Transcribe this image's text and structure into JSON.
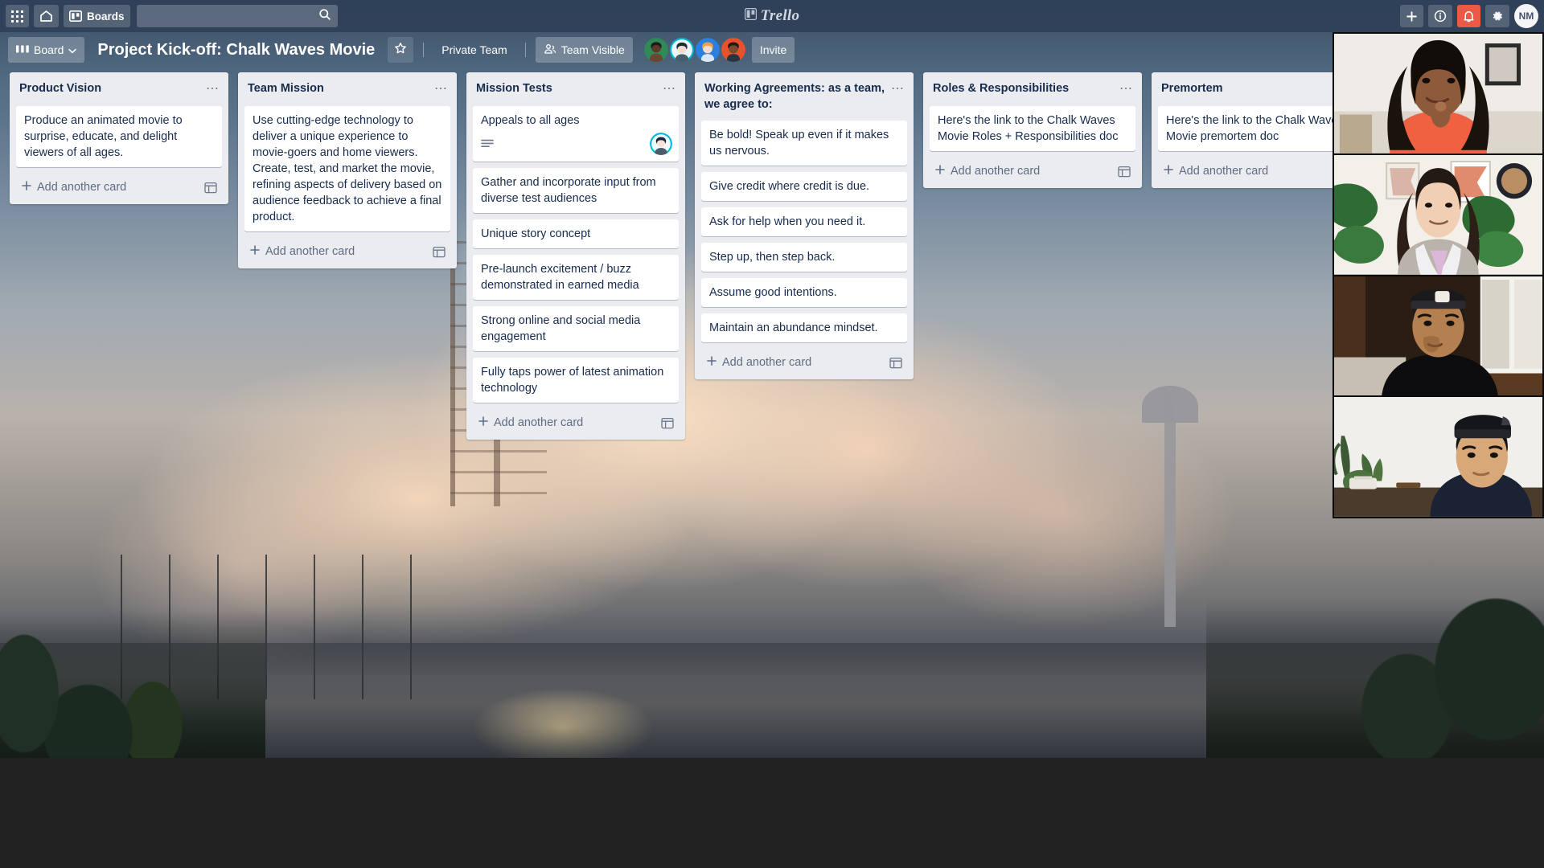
{
  "topnav": {
    "apps_icon": "grid-apps-icon",
    "home_icon": "home-icon",
    "boards_label": "Boards",
    "boards_icon": "boards-icon",
    "search_placeholder": "",
    "search_value": "",
    "search_icon": "search-icon",
    "logo_text": "Trello",
    "logo_icon": "trello-logo-icon",
    "add_icon": "plus-icon",
    "info_icon": "info-icon",
    "bell_icon": "bell-icon",
    "settings_icon": "gear-icon",
    "avatar_initials": "NM",
    "bell_color": "#eb5a46"
  },
  "boardheader": {
    "board_button_label": "Board",
    "board_button_icon": "board-view-icon",
    "board_button_caret": "chevron-down-icon",
    "title": "Project Kick-off: Chalk Waves Movie",
    "star_icon": "star-icon",
    "visibility_team_label": "Private Team",
    "visibility_label": "Team Visible",
    "visibility_icon": "team-visible-icon",
    "invite_label": "Invite",
    "members": [
      {
        "name": "member-1",
        "color": "#2e8b57",
        "skin": "#5a3a28",
        "hair": "#1b1b1b"
      },
      {
        "name": "member-2",
        "color": "#00b8d9",
        "skin": "#f3d9c8",
        "hair": "#1f2933"
      },
      {
        "name": "member-3",
        "color": "#2b7fe0",
        "skin": "#f6ddc9",
        "hair": "#f0a04b"
      },
      {
        "name": "member-4",
        "color": "#e8512e",
        "skin": "#7a4a2e",
        "hair": "#241a14"
      }
    ]
  },
  "lists": [
    {
      "title": "Product Vision",
      "menu_icon": "list-menu-icon",
      "add_card_label": "Add another card",
      "add_card_icon": "plus-icon",
      "template_icon": "card-template-icon",
      "cards": [
        {
          "text": "Produce an animated movie to surprise, educate, and delight viewers of all ages.",
          "has_description": false,
          "avatar": null
        }
      ]
    },
    {
      "title": "Team Mission",
      "menu_icon": "list-menu-icon",
      "add_card_label": "Add another card",
      "add_card_icon": "plus-icon",
      "template_icon": "card-template-icon",
      "cards": [
        {
          "text": "Use cutting-edge technology to deliver a unique experience to movie-goers and home viewers. Create, test, and market the movie, refining aspects of delivery based on audience feedback to achieve a final product.",
          "has_description": false,
          "avatar": null
        }
      ]
    },
    {
      "title": "Mission Tests",
      "menu_icon": "list-menu-icon",
      "add_card_label": "Add another card",
      "add_card_icon": "plus-icon",
      "template_icon": "card-template-icon",
      "cards": [
        {
          "text": "Appeals to all ages",
          "has_description": true,
          "avatar": {
            "name": "card-member-avatar",
            "color": "#00b8d9",
            "skin": "#f6e3d5",
            "hair": "#1c2533"
          }
        },
        {
          "text": "Gather and incorporate input from diverse test audiences",
          "has_description": false,
          "avatar": null
        },
        {
          "text": "Unique story concept",
          "has_description": false,
          "avatar": null
        },
        {
          "text": "Pre-launch excitement / buzz demonstrated in earned media",
          "has_description": false,
          "avatar": null
        },
        {
          "text": "Strong online and social media engagement",
          "has_description": false,
          "avatar": null
        },
        {
          "text": "Fully taps power of latest animation technology",
          "has_description": false,
          "avatar": null
        }
      ]
    },
    {
      "title": "Working Agreements: as a team, we agree to:",
      "menu_icon": "list-menu-icon",
      "add_card_label": "Add another card",
      "add_card_icon": "plus-icon",
      "template_icon": "card-template-icon",
      "cards": [
        {
          "text": "Be bold! Speak up even if it makes us nervous.",
          "has_description": false,
          "avatar": null
        },
        {
          "text": "Give credit where credit is due.",
          "has_description": false,
          "avatar": null
        },
        {
          "text": "Ask for help when you need it.",
          "has_description": false,
          "avatar": null
        },
        {
          "text": "Step up, then step back.",
          "has_description": false,
          "avatar": null
        },
        {
          "text": "Assume good intentions.",
          "has_description": false,
          "avatar": null
        },
        {
          "text": "Maintain an abundance mindset.",
          "has_description": false,
          "avatar": null
        }
      ]
    },
    {
      "title": "Roles & Responsibilities",
      "menu_icon": "list-menu-icon",
      "add_card_label": "Add another card",
      "add_card_icon": "plus-icon",
      "template_icon": "card-template-icon",
      "cards": [
        {
          "text": "Here's the link to the Chalk Waves Movie Roles + Responsibilities doc",
          "has_description": false,
          "avatar": null
        }
      ]
    },
    {
      "title": "Premortem",
      "menu_icon": "list-menu-icon",
      "add_card_label": "Add another card",
      "add_card_icon": "plus-icon",
      "template_icon": "card-template-icon",
      "cards": [
        {
          "text": "Here's the link to the Chalk Waves Movie premortem doc",
          "has_description": false,
          "avatar": null
        }
      ]
    }
  ],
  "video_call": {
    "tiles": [
      {
        "name": "video-tile-participant-1"
      },
      {
        "name": "video-tile-participant-2"
      },
      {
        "name": "video-tile-participant-3"
      },
      {
        "name": "video-tile-participant-4"
      }
    ]
  },
  "scrollbar": {
    "name": "board-horizontal-scrollbar"
  }
}
